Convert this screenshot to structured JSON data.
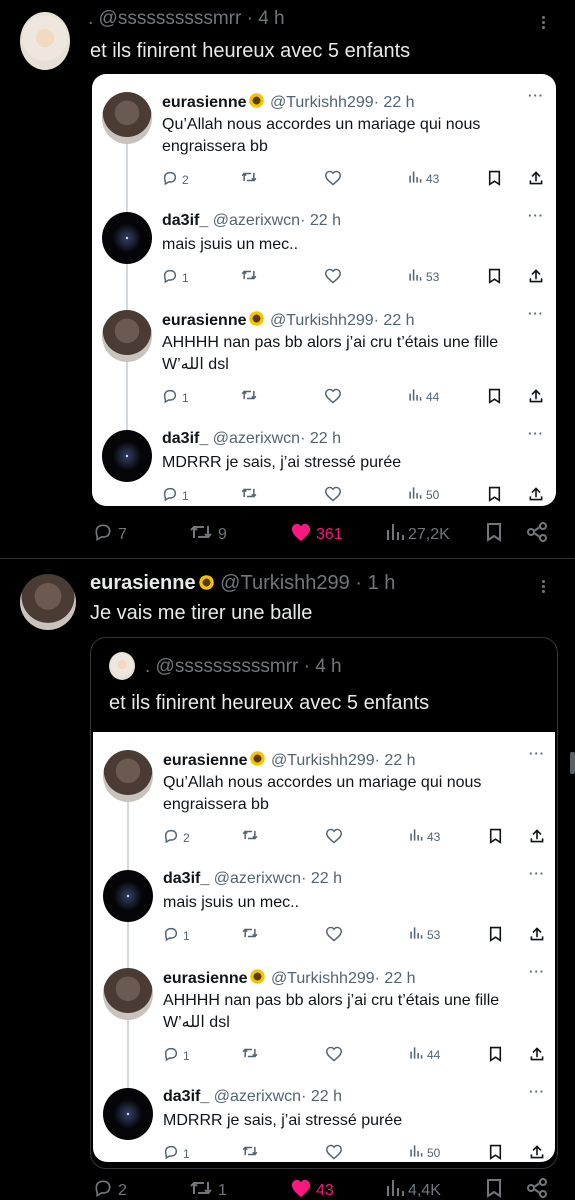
{
  "tweet1": {
    "handle": ". @ssssssssssmrr",
    "time": "· 4 h",
    "text": "et ils finirent heureux avec 5 enfants",
    "stats": {
      "replies": "7",
      "retweets": "9",
      "likes": "361",
      "views": "27,2K"
    }
  },
  "tweet2": {
    "name": "eurasienne",
    "handle": "@Turkishh299",
    "time": "· 1 h",
    "text": "Je vais me tirer une balle",
    "quote_handle": ". @ssssssssssmrr",
    "quote_time": "· 4 h",
    "quote_text": "et ils finirent heureux avec 5 enfants",
    "stats": {
      "replies": "2",
      "retweets": "1",
      "likes": "43",
      "views": "4,4K"
    }
  },
  "thread": [
    {
      "name": "eurasienne",
      "flower": true,
      "handle": "@Turkishh299",
      "time": "· 22 h",
      "text1": "Qu’Allah nous accordes un mariage qui nous",
      "text2": "engraissera bb",
      "replies": "2",
      "retweets": "",
      "likes": "",
      "views": "43",
      "avatar": "girl"
    },
    {
      "name": "da3if_",
      "flower": false,
      "handle": "@azerixwcn",
      "time": "· 22 h",
      "text1": "mais jsuis un mec..",
      "text2": "",
      "replies": "1",
      "retweets": "",
      "likes": "",
      "views": "53",
      "avatar": "space"
    },
    {
      "name": "eurasienne",
      "flower": true,
      "handle": "@Turkishh299",
      "time": "· 22 h",
      "text1": "AHHHH nan pas bb alors j’ai cru t’étais une fille",
      "text2": "W’الله dsl",
      "replies": "1",
      "retweets": "",
      "likes": "",
      "views": "44",
      "avatar": "girl"
    },
    {
      "name": "da3if_",
      "flower": false,
      "handle": "@azerixwcn",
      "time": "· 22 h",
      "text1": "MDRRR je sais, j’ai stressé purée",
      "text2": "",
      "replies": "1",
      "retweets": "",
      "likes": "",
      "views": "50",
      "avatar": "space"
    }
  ],
  "icons": [
    "reply-icon",
    "retweet-icon",
    "like-icon",
    "views-icon",
    "bookmark-icon",
    "share-icon",
    "more-icon",
    "sunflower-icon"
  ],
  "colors": {
    "like_active": "#f91880",
    "background": "#000000",
    "muted": "#71767b"
  }
}
